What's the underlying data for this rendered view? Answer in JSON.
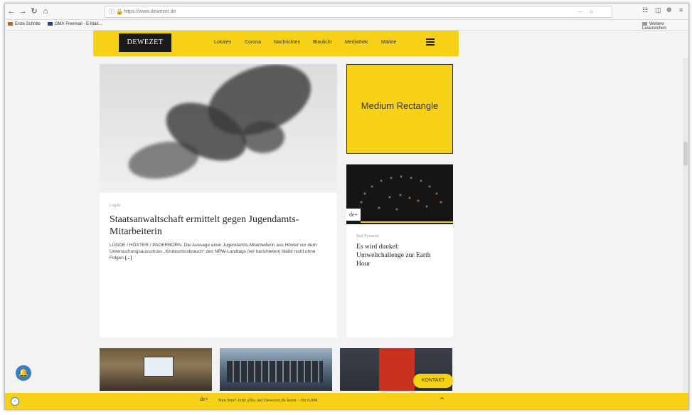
{
  "browser": {
    "url": "https://www.dewezet.de",
    "back_icon": "arrow-left-icon",
    "more_label": "···",
    "bookmarks": [
      {
        "label": "Erste Schritte",
        "color": "#e2531a"
      },
      {
        "label": "GMX Freemail - E-Mail...",
        "color": "#1c449b"
      }
    ],
    "other_bookmarks": "Weitere Lesezeichen"
  },
  "site": {
    "logo": "DEWEZET",
    "nav": [
      "Lokales",
      "Corona",
      "Nachrichten",
      "Blaulicht",
      "Mediathek",
      "Märkte"
    ],
    "brand_color": "#f7d117"
  },
  "main_article": {
    "kicker": "Lügde",
    "headline": "Staatsanwaltschaft ermittelt gegen Jugendamts-Mitarbeiterin",
    "teaser": "LÜGDE / HÖXTER / PADERBORN. Die Aussage einer Jugendamts-Mitarbeiterin aus Höxter vor dem Untersuchungsausschuss „Kindesmissbrauch“ des NRW-Landtags (wir berichteten) bleibt nicht ohne Folgen",
    "more": "[...]"
  },
  "ad": {
    "label": "Medium Rectangle"
  },
  "side_article": {
    "badge": "de+",
    "kicker": "Bad Pyrmont",
    "headline": "Es wird dunkel: Umweltchallenge zur Earth Hour"
  },
  "kontakt": "KONTAKT",
  "bottom_bar": {
    "badge": "de+",
    "promo": "Neu hier? Jetzt alles auf Dewezet.de lesen – für 0,99€"
  }
}
